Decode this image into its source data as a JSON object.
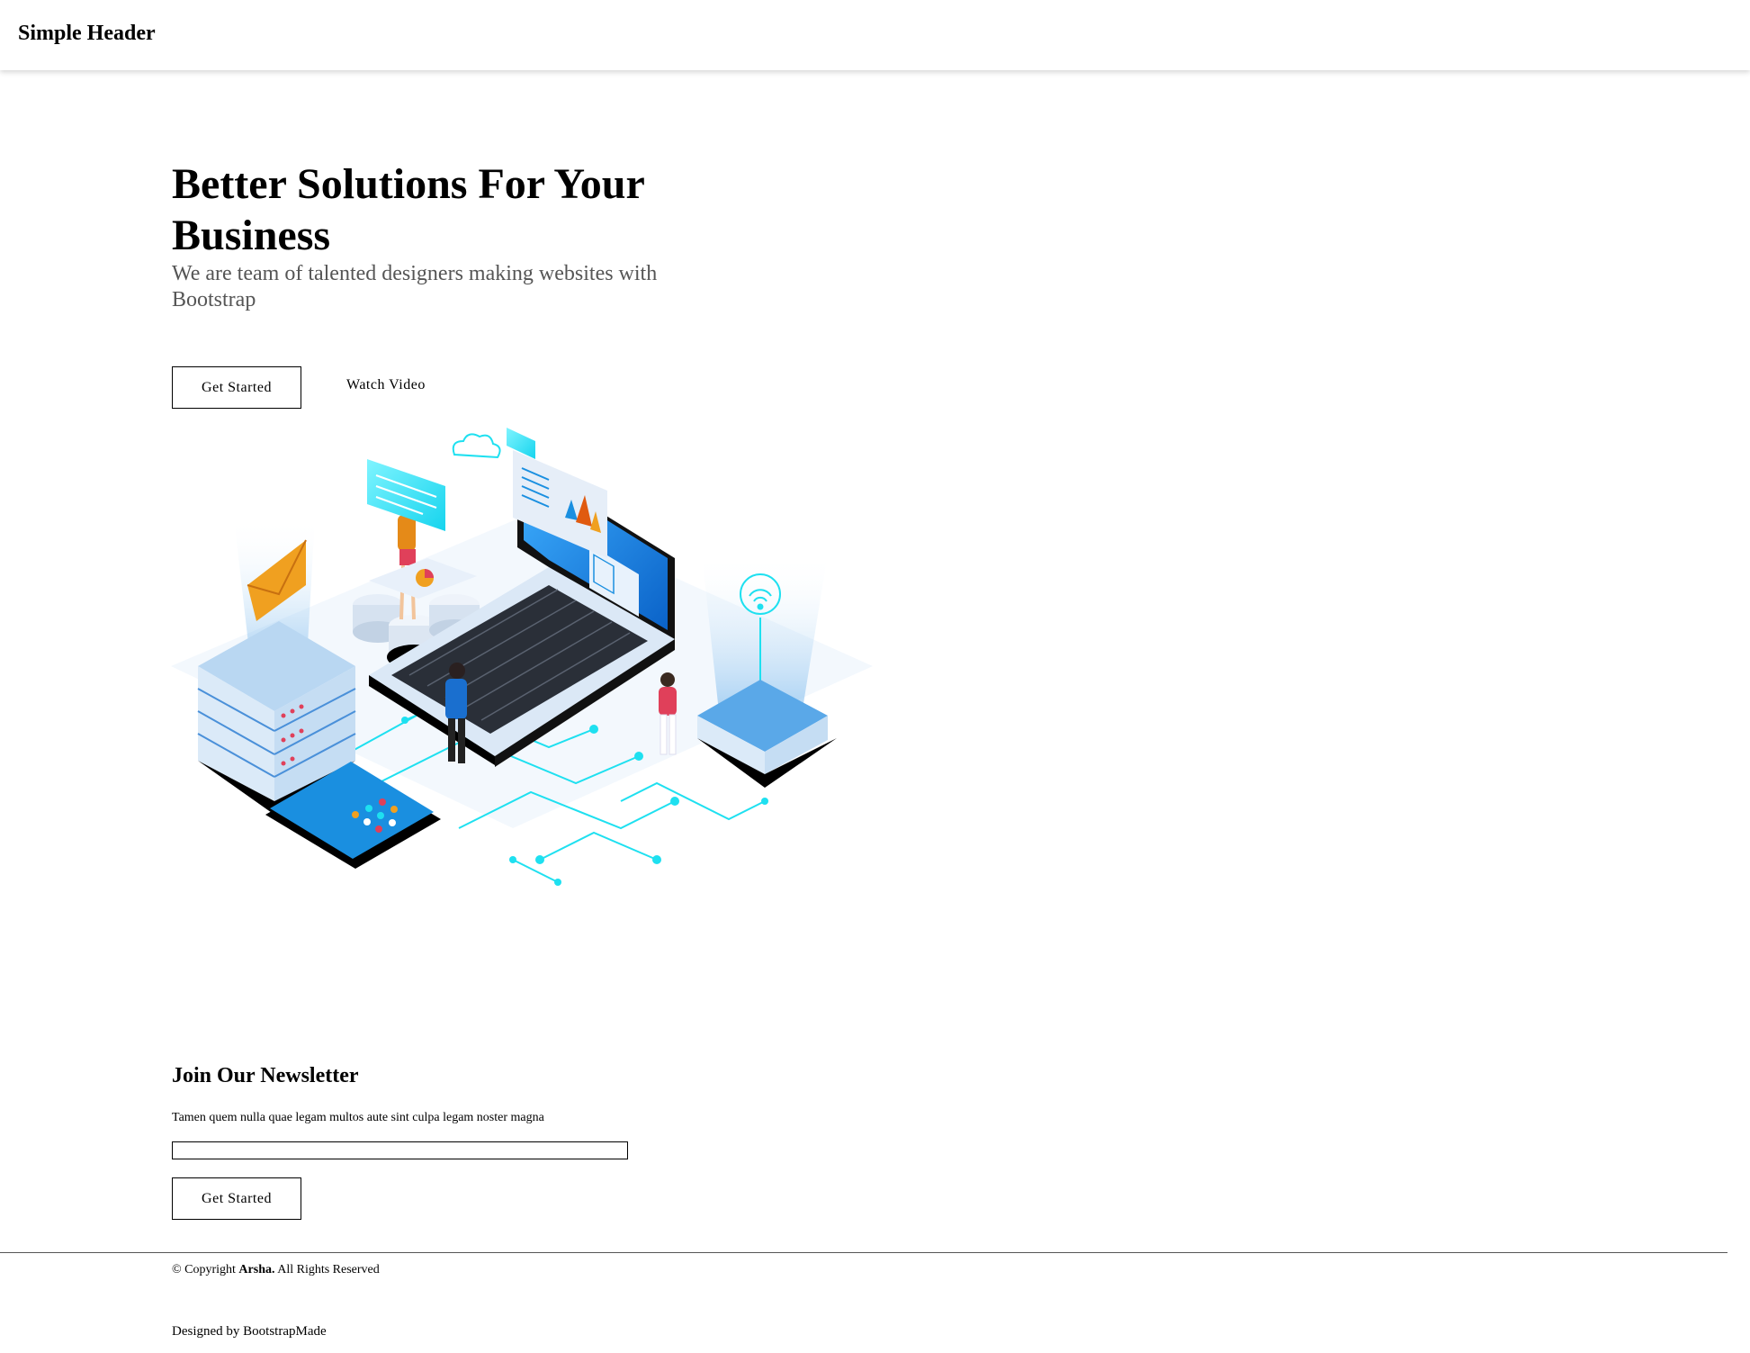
{
  "header": {
    "logo": "Simple Header"
  },
  "hero": {
    "title": "Better Solutions For Your Business",
    "subtitle": "We are team of talented designers making websites with Bootstrap",
    "primary_button": "Get Started",
    "secondary_button": "Watch Video",
    "illustration_icon": "isometric-tech-illustration"
  },
  "newsletter": {
    "title": "Join Our Newsletter",
    "text": "Tamen quem nulla quae legam multos aute sint culpa legam noster magna",
    "input_value": "",
    "button": "Get Started"
  },
  "footer": {
    "copyright_prefix": "© Copyright ",
    "brand": "Arsha.",
    "copyright_suffix": " All Rights Reserved",
    "credits": "Designed by BootstrapMade"
  },
  "colors": {
    "accent_cyan": "#1ee0f0",
    "screen_blue": "#1a8fe0",
    "envelope_orange": "#f0a020"
  }
}
